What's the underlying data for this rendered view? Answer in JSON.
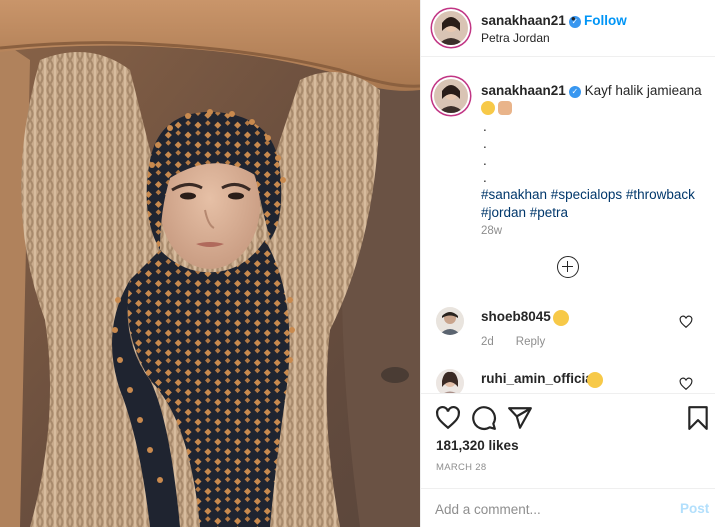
{
  "post": {
    "author": "sanakhaan21",
    "verified": true,
    "follow_label": "Follow",
    "separator": "•",
    "location": "Petra Jordan",
    "photo_alt": "Woman in knit sweater and patterned scarf posing under a rock arch",
    "caption": {
      "text": "Kayf halik jamieana",
      "emojis": [
        "smiling-face-emoji",
        "person-gesturing-emoji"
      ],
      "dots": [
        ".",
        ".",
        ".",
        "."
      ],
      "hashtags_line1": "#sanakhan #specialops #throwback",
      "hashtags_line2": "#jordan #petra",
      "age": "28w"
    },
    "load_more_icon": "plus-circle-icon"
  },
  "comments": [
    {
      "user": "shoeb8045",
      "emoji": "wink-kiss-emoji",
      "age": "2d",
      "reply_label": "Reply"
    },
    {
      "user": "ruhi_amin_official",
      "emoji": "heart-eyes-emoji"
    }
  ],
  "actions": {
    "icons": [
      "heart-icon",
      "comment-icon",
      "share-icon",
      "bookmark-icon"
    ],
    "likes": "181,320 likes",
    "date": "MARCH 28"
  },
  "add_comment": {
    "placeholder": "Add a comment...",
    "post_label": "Post"
  },
  "colors": {
    "accent_blue": "#0095f6",
    "hashtag": "#00376b",
    "muted": "#8e8e8e",
    "post_disabled": "#b2dffc"
  }
}
